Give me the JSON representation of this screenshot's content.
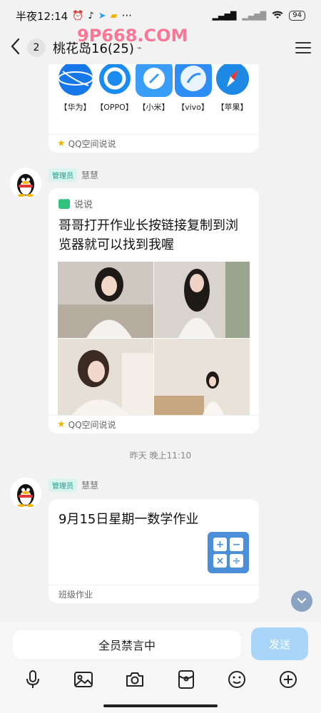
{
  "status": {
    "time": "半夜12:14",
    "more": "···",
    "battery": "94"
  },
  "header": {
    "back_label": "‹",
    "unread_count": "2",
    "title": "桃花岛16(25)"
  },
  "watermark": "9P668.COM",
  "messages": {
    "apps_card": {
      "apps": [
        {
          "label": "【华为】",
          "icon": "huawei-browser-icon",
          "color": "#1677e8"
        },
        {
          "label": "【OPPO】",
          "icon": "oppo-browser-icon",
          "color": "#1a8cf0"
        },
        {
          "label": "【小米】",
          "icon": "xiaomi-browser-icon",
          "color": "#3a9ef8"
        },
        {
          "label": "【vivo】",
          "icon": "vivo-browser-icon",
          "color": "#2f8ef5"
        },
        {
          "label": "【苹果】",
          "icon": "safari-icon",
          "color": "#1e88e5"
        }
      ],
      "footer": "QQ空间说说"
    },
    "post": {
      "role": "管理员",
      "sender": "慧慧",
      "type_label": "说说",
      "text": "哥哥打开作业长按链接复制到浏览器就可以找到我喔",
      "footer": "QQ空间说说"
    },
    "timestamp": "昨天 晚上11:10",
    "homework": {
      "role": "管理员",
      "sender": "慧慧",
      "title": "9月15日星期一数学作业",
      "footer": "班级作业",
      "calc_keys": [
        "+",
        "−",
        "×",
        "÷"
      ]
    }
  },
  "bottom": {
    "input_text": "全员禁言中",
    "send_label": "发送"
  }
}
